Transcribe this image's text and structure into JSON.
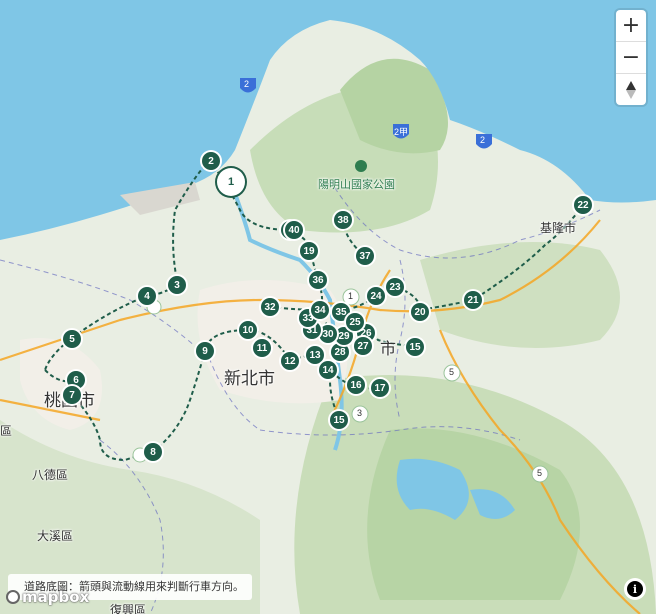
{
  "places": [
    {
      "id": "xinbei",
      "label": "新北市",
      "kind": "city"
    },
    {
      "id": "taoyuan",
      "label": "桃園市",
      "kind": "city"
    },
    {
      "id": "keelung",
      "label": "基隆市",
      "kind": "town"
    },
    {
      "id": "bade",
      "label": "八德區",
      "kind": "town"
    },
    {
      "id": "daxi",
      "label": "大溪區",
      "kind": "town"
    },
    {
      "id": "yangmingshan",
      "label": "陽明山國家公園",
      "kind": "park"
    },
    {
      "id": "fuxing",
      "label": "復興區",
      "kind": "town"
    },
    {
      "id": "edge-qu",
      "label": "區",
      "kind": "town"
    },
    {
      "id": "center-fragment",
      "label": "市",
      "kind": "town"
    }
  ],
  "road_shields": [
    "2",
    "2",
    "2甲",
    "1",
    "3",
    "5",
    "5"
  ],
  "stations": [
    "1",
    "2",
    "3",
    "4",
    "5",
    "6",
    "7",
    "8",
    "9",
    "10",
    "11",
    "12",
    "13",
    "14",
    "15",
    "16",
    "17",
    "19",
    "20",
    "21",
    "22",
    "23",
    "24",
    "26",
    "27",
    "28",
    "29",
    "30",
    "31",
    "32",
    "33",
    "34",
    "35",
    "36",
    "37",
    "38",
    "39",
    "40",
    "15",
    "25"
  ],
  "controls": {
    "zoom_in": "+",
    "zoom_out": "−",
    "compass": "▲"
  },
  "attribution": {
    "note": "道路底圖：箭頭與流動線用來判斷行車方向。",
    "logo": "mapbox",
    "info": "i"
  },
  "colors": {
    "water": "#7fc6e6",
    "marker": "#1f5d4a",
    "route": "#1f5d4a",
    "highway": "#f5a623",
    "boundary": "#6a6fc0"
  }
}
